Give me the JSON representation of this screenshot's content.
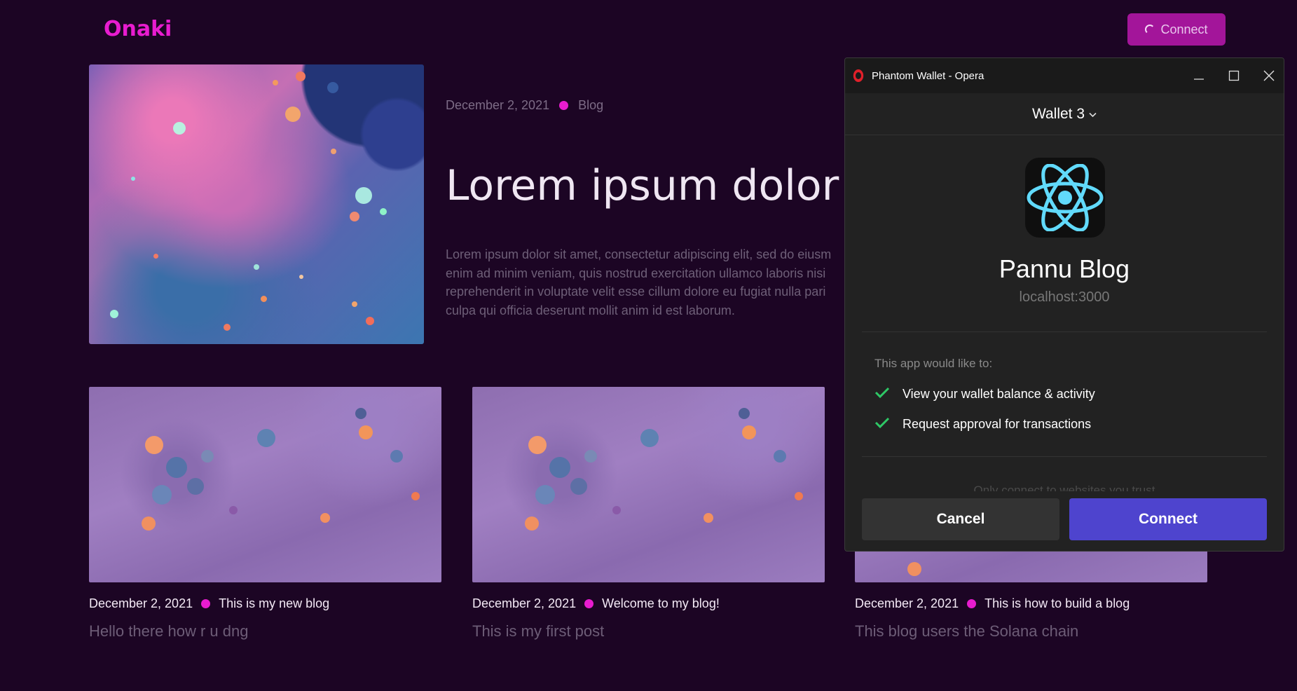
{
  "header": {
    "logo": "Onaki",
    "connect_label": "Connect"
  },
  "hero": {
    "date": "December 2, 2021",
    "category": "Blog",
    "title": "Lorem ipsum dolor sit",
    "body": "Lorem ipsum dolor sit amet, consectetur adipiscing elit, sed do eiusm\nenim ad minim veniam, quis nostrud exercitation ullamco laboris nisi\nreprehenderit in voluptate velit esse cillum dolore eu fugiat nulla pari\nculpa qui officia deserunt mollit anim id est laborum."
  },
  "posts": [
    {
      "date": "December 2, 2021",
      "tag": "This is my new blog",
      "title": "Hello there how r u dng"
    },
    {
      "date": "December 2, 2021",
      "tag": "Welcome to my blog!",
      "title": "This is my first post"
    },
    {
      "date": "December 2, 2021",
      "tag": "This is how to build a blog",
      "title": "This blog users the Solana chain"
    }
  ],
  "popup": {
    "window_title": "Phantom Wallet - Opera",
    "wallet_name": "Wallet 3",
    "app_name": "Pannu Blog",
    "app_url": "localhost:3000",
    "permissions_heading": "This app would like to:",
    "permissions": [
      "View your wallet balance & activity",
      "Request approval for transactions"
    ],
    "faded_text": "Only connect to websites you trust",
    "cancel_label": "Cancel",
    "connect_label": "Connect"
  },
  "colors": {
    "background": "#1c0524",
    "accent": "#e81ccf",
    "phantom_purple": "#4e44ce"
  }
}
